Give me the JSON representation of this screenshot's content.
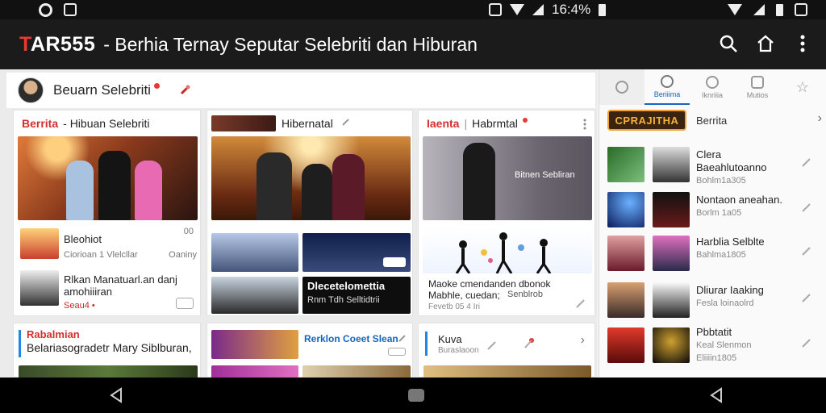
{
  "status_bar": {
    "time": "16:4%"
  },
  "app_bar": {
    "brand_a": "T",
    "brand_b": "AR555",
    "title": "- Berhia Ternay Seputar Selebriti dan Hiburan"
  },
  "header": {
    "title": "Beuarn Selebriti"
  },
  "cards": {
    "c1": {
      "tag": "Berrita",
      "title": "- Hibuan Selebriti"
    },
    "c1_list": [
      {
        "title": "Bleohiot",
        "meta": "Ciorioan 1 Vlelcllar",
        "extra": "Oaniny",
        "count": "00"
      },
      {
        "title": "Rlkan Manatuarl.an danj amohiiiran",
        "meta": "Seau4 •"
      }
    ],
    "c2": {
      "title": "Hibernatal"
    },
    "c3": {
      "tag": "Iaenta",
      "title": "Habrmtal"
    },
    "c3_hero_text": "Bitnen Sebliran",
    "c2_dark_title": "Dlecetelomettia",
    "c2_dark_sub": "Rnm Tdh Selltidtrii",
    "c3_title": "Maoke cmendanden dbonok Mabhle, cuedan;",
    "c3_extra": "Senblrob",
    "c3_meta": "Fevetb 05 4 Iri",
    "c4": {
      "tag": "Rabalmian",
      "title": "Belariasogradetr Mary Siblburan,"
    },
    "c5": {
      "title": "Rerklon Coeet Slean"
    },
    "c6": {
      "title": "Kuva",
      "meta": "Buraslaoon"
    }
  },
  "sidebar": {
    "tabs": [
      "Beriiima",
      "Iknriiia",
      "Mutios"
    ],
    "logo_text": "CPRAJITHA",
    "head_label": "Berrita",
    "items": [
      {
        "title": "Clera Baeahlutoanno",
        "meta": "Bohlm1a305"
      },
      {
        "title": "Nontaon aneahan.",
        "meta": "Borlm 1a05"
      },
      {
        "title": "Harblia Selblte",
        "meta": "Bahlma1805"
      },
      {
        "title": "Dliurar Iaaking",
        "meta": "Fesla loinaolrd"
      },
      {
        "title": "Pbbtatit",
        "meta": "Keal Slenmon"
      }
    ],
    "item5_extra": "Eliiiin1805"
  },
  "colors": {
    "accent": "#1565c0",
    "brand_red": "#e53935",
    "appbar": "#1b1b1b"
  }
}
